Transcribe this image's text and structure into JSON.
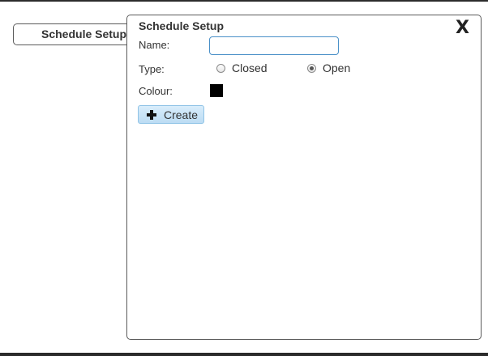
{
  "tab": {
    "label": "Schedule Setup"
  },
  "panel": {
    "title": "Schedule Setup",
    "close_label": "X"
  },
  "form": {
    "name": {
      "label": "Name:",
      "value": "",
      "placeholder": ""
    },
    "type": {
      "label": "Type:",
      "options": [
        {
          "label": "Closed",
          "checked": false
        },
        {
          "label": "Open",
          "checked": true
        }
      ]
    },
    "colour": {
      "label": "Colour:",
      "value": "#000000"
    },
    "create_button": {
      "label": "Create",
      "icon": "plus-icon"
    }
  }
}
